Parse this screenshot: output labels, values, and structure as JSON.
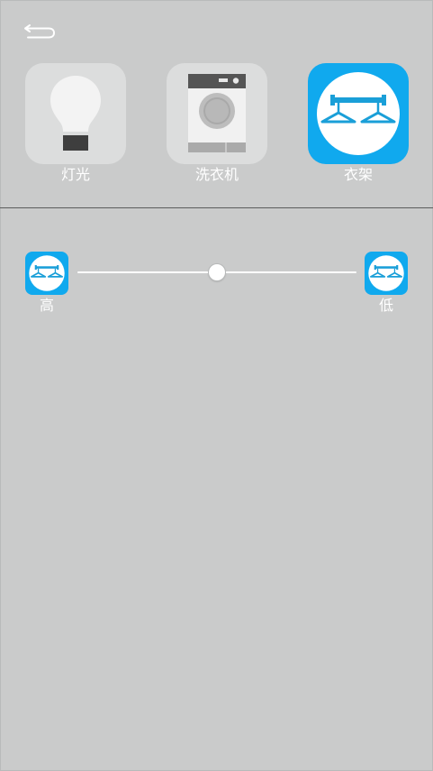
{
  "devices": [
    {
      "label": "灯光",
      "icon": "light-bulb-icon",
      "active": false
    },
    {
      "label": "洗衣机",
      "icon": "washing-machine-icon",
      "active": false
    },
    {
      "label": "衣架",
      "icon": "clothes-rack-icon",
      "active": true
    }
  ],
  "rack_control": {
    "high_label": "高",
    "low_label": "低",
    "position_fraction": 0.5
  },
  "colors": {
    "background": "#cacbcb",
    "tile": "#dcdddd",
    "accent": "#10a9ee",
    "text": "#ffffff"
  },
  "icons": {
    "back": "back-arrow-icon",
    "end_buttons": "clothes-rack-icon"
  }
}
